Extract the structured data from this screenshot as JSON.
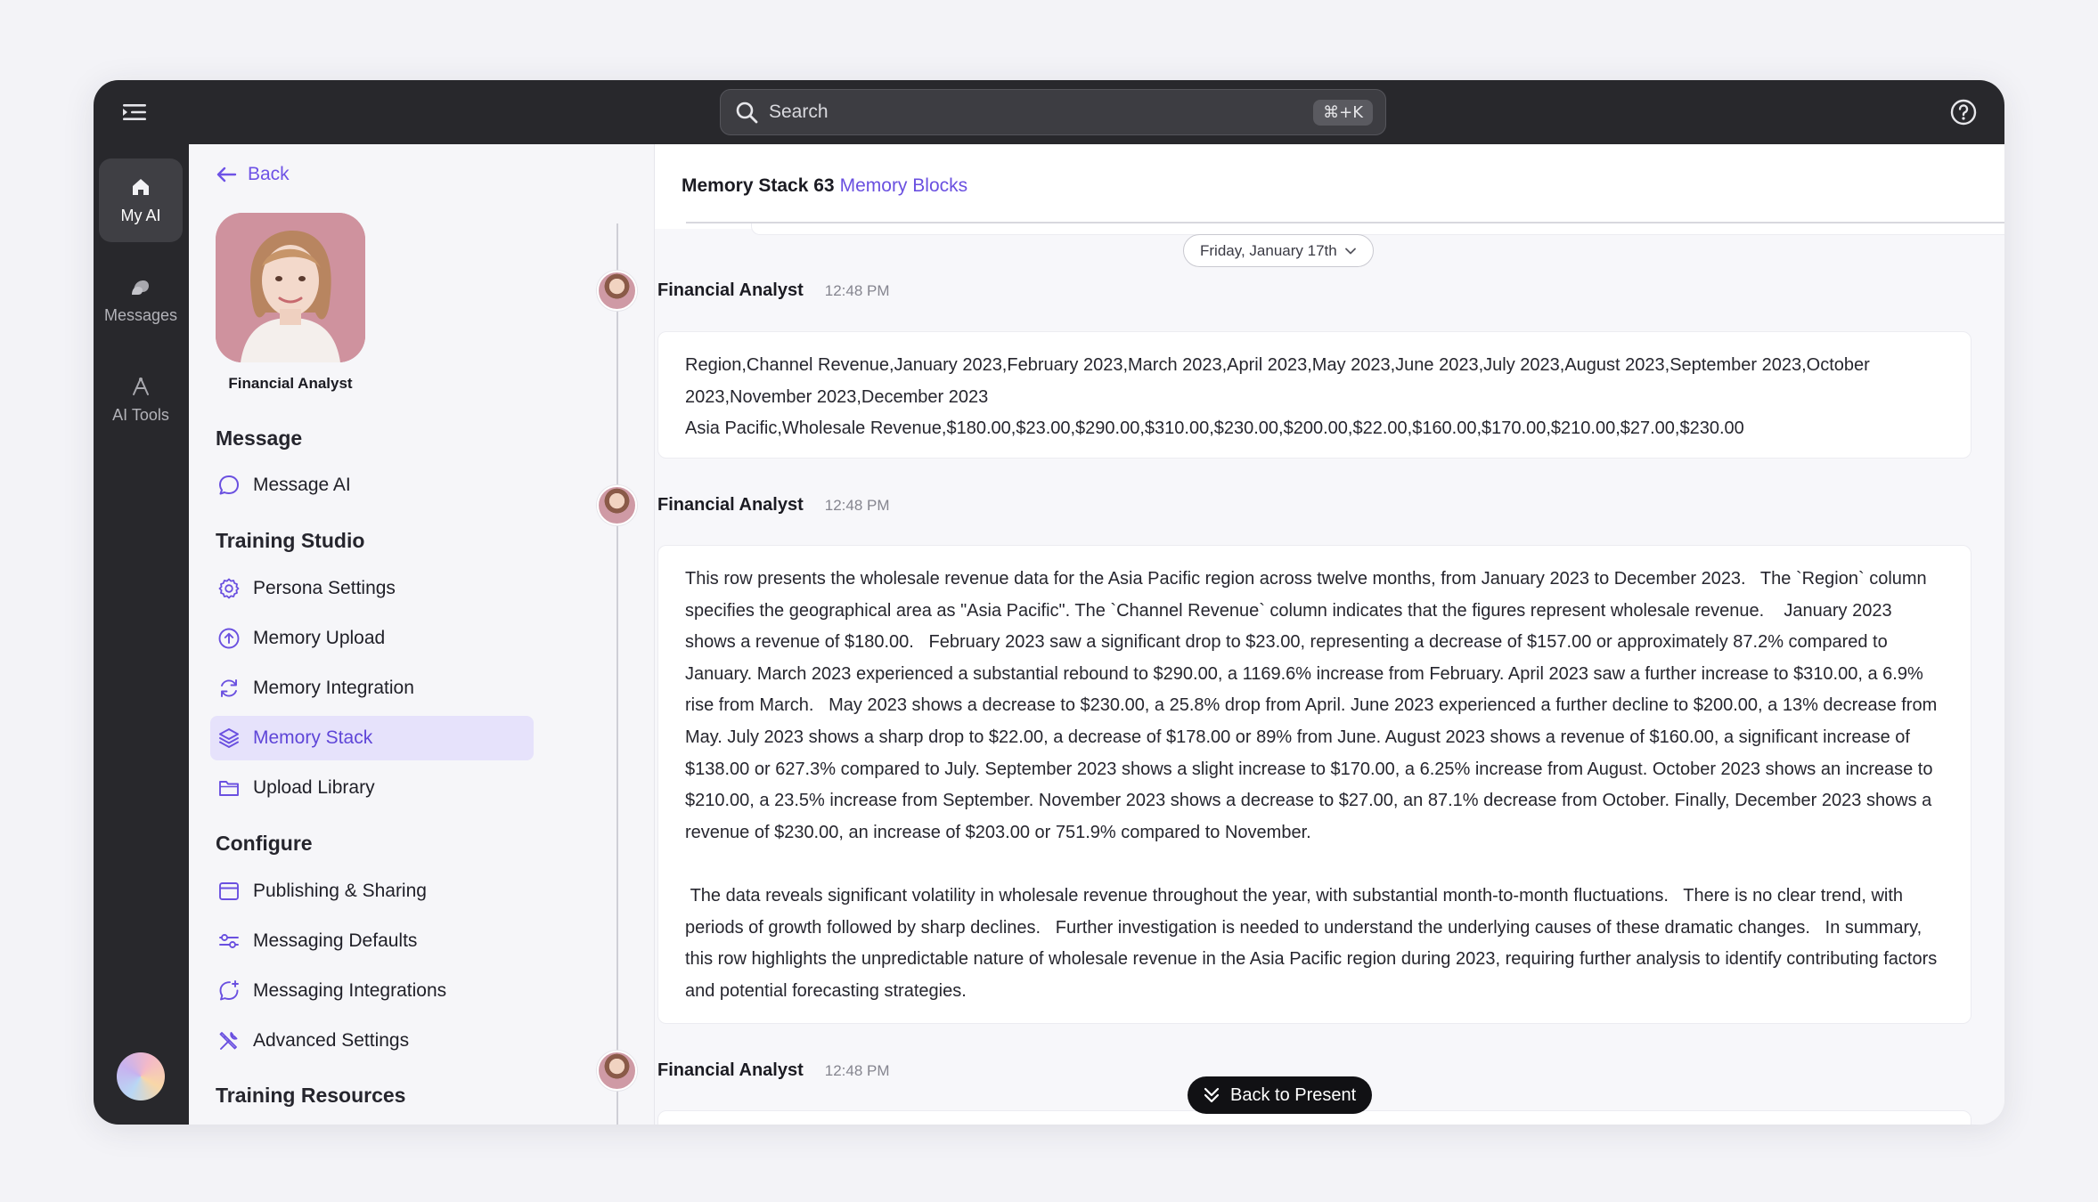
{
  "topbar": {
    "search_placeholder": "Search",
    "search_shortcut": "⌘+K"
  },
  "rail": {
    "items": [
      {
        "label": "My AI",
        "icon": "home-icon",
        "active": true
      },
      {
        "label": "Messages",
        "icon": "messages-icon",
        "active": false
      },
      {
        "label": "AI Tools",
        "icon": "ai-tools-icon",
        "active": false
      }
    ]
  },
  "sidebar": {
    "back_label": "Back",
    "persona_name": "Financial Analyst",
    "sections": [
      {
        "title": "Message",
        "items": [
          {
            "label": "Message AI",
            "icon": "chat-bubble-icon"
          }
        ]
      },
      {
        "title": "Training Studio",
        "items": [
          {
            "label": "Persona Settings",
            "icon": "gear-icon"
          },
          {
            "label": "Memory Upload",
            "icon": "upload-circle-icon"
          },
          {
            "label": "Memory Integration",
            "icon": "refresh-icon"
          },
          {
            "label": "Memory Stack",
            "icon": "layers-icon",
            "active": true
          },
          {
            "label": "Upload Library",
            "icon": "folder-icon"
          }
        ]
      },
      {
        "title": "Configure",
        "items": [
          {
            "label": "Publishing & Sharing",
            "icon": "browser-window-icon"
          },
          {
            "label": "Messaging Defaults",
            "icon": "sliders-icon"
          },
          {
            "label": "Messaging Integrations",
            "icon": "chat-plus-icon"
          },
          {
            "label": "Advanced Settings",
            "icon": "tools-icon"
          }
        ]
      },
      {
        "title": "Training Resources",
        "items": []
      }
    ]
  },
  "main": {
    "breadcrumb_title": "Memory Stack 63",
    "breadcrumb_link": "Memory Blocks",
    "date_label": "Friday, January 17th",
    "messages": [
      {
        "author": "Financial Analyst",
        "time": "12:48 PM",
        "text": "Region,Channel Revenue,January 2023,February 2023,March 2023,April 2023,May 2023,June 2023,July 2023,August 2023,September 2023,October 2023,November 2023,December 2023\nAsia Pacific,Wholesale Revenue,$180.00,$23.00,$290.00,$310.00,$230.00,$200.00,$22.00,$160.00,$170.00,$210.00,$27.00,$230.00"
      },
      {
        "author": "Financial Analyst",
        "time": "12:48 PM",
        "text": "This row presents the wholesale revenue data for the Asia Pacific region across twelve months, from January 2023 to December 2023.   The `Region` column specifies the geographical area as \"Asia Pacific\". The `Channel Revenue` column indicates that the figures represent wholesale revenue.    January 2023 shows a revenue of $180.00.   February 2023 saw a significant drop to $23.00, representing a decrease of $157.00 or approximately 87.2% compared to January. March 2023 experienced a substantial rebound to $290.00, a 1169.6% increase from February. April 2023 saw a further increase to $310.00, a 6.9% rise from March.   May 2023 shows a decrease to $230.00, a 25.8% drop from April. June 2023 experienced a further decline to $200.00, a 13% decrease from May. July 2023 shows a sharp drop to $22.00, a decrease of $178.00 or 89% from June. August 2023 shows a revenue of $160.00, a significant increase of $138.00 or 627.3% compared to July. September 2023 shows a slight increase to $170.00, a 6.25% increase from August. October 2023 shows an increase to $210.00, a 23.5% increase from September. November 2023 shows a decrease to $27.00, an 87.1% decrease from October. Finally, December 2023 shows a revenue of $230.00, an increase of $203.00 or 751.9% compared to November.\n\n The data reveals significant volatility in wholesale revenue throughout the year, with substantial month-to-month fluctuations.   There is no clear trend, with periods of growth followed by sharp declines.   Further investigation is needed to understand the underlying causes of these dramatic changes.   In summary, this row highlights the unpredictable nature of wholesale revenue in the Asia Pacific region during 2023, requiring further analysis to identify contributing factors and potential forecasting strategies."
      },
      {
        "author": "Financial Analyst",
        "time": "12:48 PM",
        "text": ""
      }
    ],
    "back_to_present_label": "Back to Present"
  },
  "colors": {
    "accent": "#6a50e0",
    "topbar": "#28282c",
    "active_nav_bg": "#e6e2fb"
  }
}
